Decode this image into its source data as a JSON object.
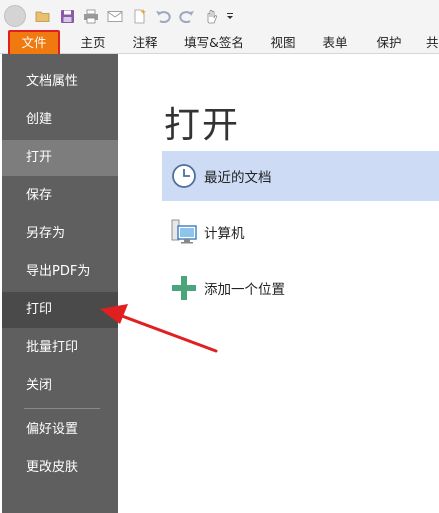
{
  "quick_access": {
    "icons": [
      "app-orb",
      "open-folder-icon",
      "save-icon",
      "print-icon",
      "email-icon",
      "new-icon",
      "undo-icon",
      "redo-icon",
      "hand-tool-icon",
      "customize-dropdown-icon"
    ]
  },
  "ribbon": {
    "tabs": [
      {
        "label": "文件"
      },
      {
        "label": "主页"
      },
      {
        "label": "注释"
      },
      {
        "label": "填写&签名"
      },
      {
        "label": "视图"
      },
      {
        "label": "表单"
      },
      {
        "label": "保护"
      },
      {
        "label": "共"
      }
    ],
    "active_tab_color": "#f07a10",
    "highlight_border_color": "#e02020"
  },
  "backstage": {
    "nav": [
      {
        "label": "文档属性"
      },
      {
        "label": "创建"
      },
      {
        "label": "打开"
      },
      {
        "label": "保存"
      },
      {
        "label": "另存为"
      },
      {
        "label": "导出PDF为"
      },
      {
        "label": "打印"
      },
      {
        "label": "批量打印"
      },
      {
        "label": "关闭"
      },
      {
        "label": "偏好设置"
      },
      {
        "label": "更改皮肤"
      }
    ],
    "selected": "打开",
    "hovered": "打印"
  },
  "main": {
    "title": "打开",
    "locations": [
      {
        "label": "最近的文档",
        "icon": "clock-icon"
      },
      {
        "label": "计算机",
        "icon": "computer-icon"
      },
      {
        "label": "添加一个位置",
        "icon": "plus-icon"
      }
    ],
    "selected_bg": "#cddcf4"
  },
  "annotation": {
    "arrow_color": "#e02020"
  }
}
